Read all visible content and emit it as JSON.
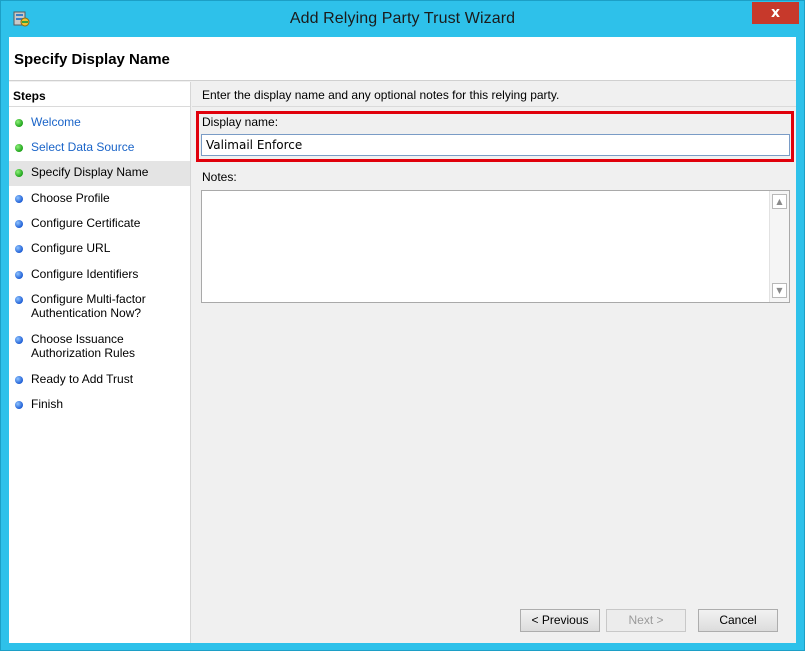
{
  "window": {
    "title": "Add Relying Party Trust Wizard",
    "close_glyph": "x",
    "icon": "server-trust-icon"
  },
  "header": {
    "title": "Specify Display Name"
  },
  "steps": {
    "heading": "Steps",
    "items": [
      {
        "label": "Welcome",
        "state": "done"
      },
      {
        "label": "Select Data Source",
        "state": "done"
      },
      {
        "label": "Specify Display Name",
        "state": "current"
      },
      {
        "label": "Choose Profile",
        "state": "pending"
      },
      {
        "label": "Configure Certificate",
        "state": "pending"
      },
      {
        "label": "Configure URL",
        "state": "pending"
      },
      {
        "label": "Configure Identifiers",
        "state": "pending"
      },
      {
        "label": "Configure Multi-factor Authentication Now?",
        "state": "pending"
      },
      {
        "label": "Choose Issuance Authorization Rules",
        "state": "pending"
      },
      {
        "label": "Ready to Add Trust",
        "state": "pending"
      },
      {
        "label": "Finish",
        "state": "pending"
      }
    ]
  },
  "main": {
    "instruction": "Enter the display name and any optional notes for this relying party.",
    "display_name_label": "Display name:",
    "display_name_value": "Valimail Enforce",
    "notes_label": "Notes:",
    "notes_value": ""
  },
  "buttons": {
    "previous": "< Previous",
    "next": "Next >",
    "cancel": "Cancel"
  },
  "colors": {
    "frame": "#2ec1ea",
    "highlight": "#e0000b",
    "close": "#c7392b",
    "done_link": "#1a64c8"
  }
}
